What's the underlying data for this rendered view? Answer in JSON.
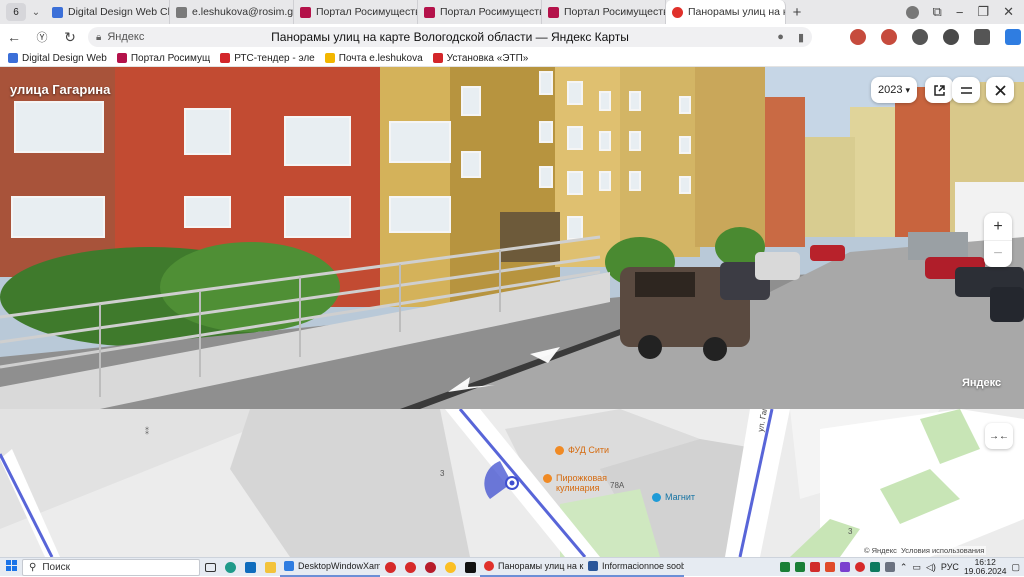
{
  "browser": {
    "tab_count": "6",
    "tabs": [
      {
        "label": "Digital Design Web Clie",
        "color": "#3b6fd8",
        "active": false
      },
      {
        "label": "e.leshukova@rosim.gov",
        "color": "#7a7a7a",
        "active": false
      },
      {
        "label": "Портал Росимущества",
        "color": "#b4124a",
        "active": false
      },
      {
        "label": "Портал Росимущества",
        "color": "#b4124a",
        "active": false
      },
      {
        "label": "Портал Росимущества",
        "color": "#b4124a",
        "active": false
      },
      {
        "label": "Панорамы улиц на к",
        "color": "#e0312b",
        "active": true
      }
    ],
    "new_tab_label": "+",
    "url_host": "Яндекс",
    "page_title": "Панорамы улиц на карте Вологодской области — Яндекс Карты",
    "bookmarks": [
      {
        "label": "Digital Design Web",
        "color": "#3b6fd8"
      },
      {
        "label": "Портал Росимущ",
        "color": "#b4124a"
      },
      {
        "label": "РТС-тендер - эле",
        "color": "#d3262a"
      },
      {
        "label": "Почта e.leshukova",
        "color": "#f2b600"
      },
      {
        "label": "Установка «ЭТП»",
        "color": "#d3262a"
      }
    ]
  },
  "panorama": {
    "street_name": "улица Гагарина",
    "year": "2023",
    "year_caret": "▾",
    "zoom_in": "+",
    "zoom_out": "−",
    "watermark": "Яндекс"
  },
  "map": {
    "pois": [
      {
        "label": "ФУД Сити",
        "color": "#f08a24"
      },
      {
        "label": "Пирожковая кулинария",
        "color": "#f08a24"
      },
      {
        "label": "Магнит",
        "color": "#1e9bd7"
      }
    ],
    "house_numbers": [
      "3",
      "78А",
      "3"
    ],
    "street_label": "ул. Гагарина",
    "footer_copyright": "© Яндекс",
    "footer_terms": "Условия использования"
  },
  "taskbar": {
    "search_placeholder": "Поиск",
    "windows": [
      {
        "label": "DesktopWindowXaml...",
        "color": "#2f7de1"
      },
      {
        "label": "Панорамы улиц на к...",
        "color": "#e0312b"
      },
      {
        "label": "Informacionnoe soob...",
        "color": "#2b579a"
      }
    ],
    "language": "РУС",
    "time": "16:12",
    "date": "19.06.2024"
  }
}
